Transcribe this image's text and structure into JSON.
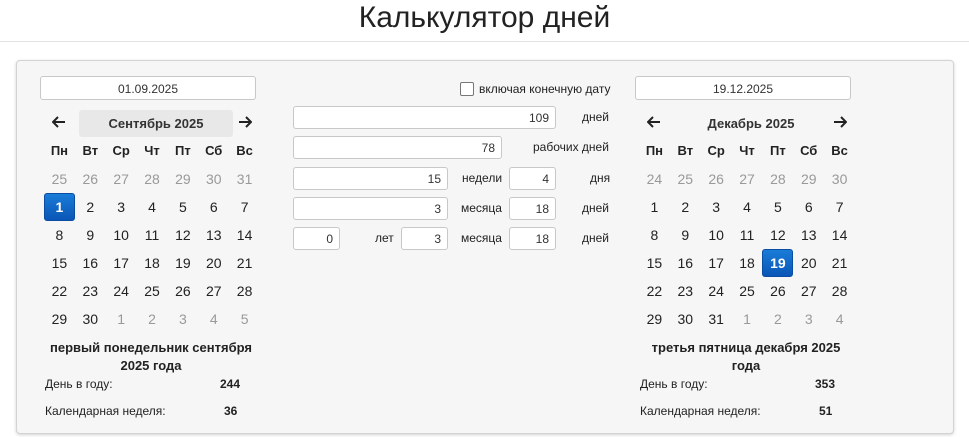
{
  "page": {
    "title": "Калькулятор дней"
  },
  "start": {
    "date": "01.09.2025",
    "calendar": {
      "month_label": "Сентябрь 2025",
      "prev_icon": "arrow-left",
      "next_icon": "arrow-right",
      "weekdays": [
        "Пн",
        "Вт",
        "Ср",
        "Чт",
        "Пт",
        "Сб",
        "Вс"
      ],
      "days": [
        {
          "d": "25",
          "muted": true
        },
        {
          "d": "26",
          "muted": true
        },
        {
          "d": "27",
          "muted": true
        },
        {
          "d": "28",
          "muted": true
        },
        {
          "d": "29",
          "muted": true
        },
        {
          "d": "30",
          "muted": true
        },
        {
          "d": "31",
          "muted": true
        },
        {
          "d": "1",
          "selected": true
        },
        {
          "d": "2"
        },
        {
          "d": "3"
        },
        {
          "d": "4"
        },
        {
          "d": "5"
        },
        {
          "d": "6"
        },
        {
          "d": "7"
        },
        {
          "d": "8"
        },
        {
          "d": "9"
        },
        {
          "d": "10"
        },
        {
          "d": "11"
        },
        {
          "d": "12"
        },
        {
          "d": "13"
        },
        {
          "d": "14"
        },
        {
          "d": "15"
        },
        {
          "d": "16"
        },
        {
          "d": "17"
        },
        {
          "d": "18"
        },
        {
          "d": "19"
        },
        {
          "d": "20"
        },
        {
          "d": "21"
        },
        {
          "d": "22"
        },
        {
          "d": "23"
        },
        {
          "d": "24"
        },
        {
          "d": "25"
        },
        {
          "d": "26"
        },
        {
          "d": "27"
        },
        {
          "d": "28"
        },
        {
          "d": "29"
        },
        {
          "d": "30"
        },
        {
          "d": "1",
          "muted": true
        },
        {
          "d": "2",
          "muted": true
        },
        {
          "d": "3",
          "muted": true
        },
        {
          "d": "4",
          "muted": true
        },
        {
          "d": "5",
          "muted": true
        }
      ]
    },
    "caption": "первый понедельник сентября 2025 года",
    "day_of_year_label": "День в году:",
    "day_of_year": "244",
    "week_label": "Календарная неделя:",
    "week": "36"
  },
  "end": {
    "date": "19.12.2025",
    "calendar": {
      "month_label": "Декабрь 2025",
      "prev_icon": "arrow-left",
      "next_icon": "arrow-right",
      "weekdays": [
        "Пн",
        "Вт",
        "Ср",
        "Чт",
        "Пт",
        "Сб",
        "Вс"
      ],
      "days": [
        {
          "d": "24",
          "muted": true
        },
        {
          "d": "25",
          "muted": true
        },
        {
          "d": "26",
          "muted": true
        },
        {
          "d": "27",
          "muted": true
        },
        {
          "d": "28",
          "muted": true
        },
        {
          "d": "29",
          "muted": true
        },
        {
          "d": "30",
          "muted": true
        },
        {
          "d": "1"
        },
        {
          "d": "2"
        },
        {
          "d": "3"
        },
        {
          "d": "4"
        },
        {
          "d": "5"
        },
        {
          "d": "6"
        },
        {
          "d": "7"
        },
        {
          "d": "8"
        },
        {
          "d": "9"
        },
        {
          "d": "10"
        },
        {
          "d": "11"
        },
        {
          "d": "12"
        },
        {
          "d": "13"
        },
        {
          "d": "14"
        },
        {
          "d": "15"
        },
        {
          "d": "16"
        },
        {
          "d": "17"
        },
        {
          "d": "18"
        },
        {
          "d": "19",
          "selected": true
        },
        {
          "d": "20"
        },
        {
          "d": "21"
        },
        {
          "d": "22"
        },
        {
          "d": "23"
        },
        {
          "d": "24"
        },
        {
          "d": "25"
        },
        {
          "d": "26"
        },
        {
          "d": "27"
        },
        {
          "d": "28"
        },
        {
          "d": "29"
        },
        {
          "d": "30"
        },
        {
          "d": "31"
        },
        {
          "d": "1",
          "muted": true
        },
        {
          "d": "2",
          "muted": true
        },
        {
          "d": "3",
          "muted": true
        },
        {
          "d": "4",
          "muted": true
        }
      ]
    },
    "caption": "третья пятница декабря 2025 года",
    "day_of_year_label": "День в году:",
    "day_of_year": "353",
    "week_label": "Календарная неделя:",
    "week": "51"
  },
  "calc": {
    "include_end_label": "включая конечную дату",
    "include_end_checked": false,
    "days_value": "109",
    "days_label": "дней",
    "workdays_value": "78",
    "workdays_label": "рабочих дней",
    "weeks_value": "15",
    "weeks_label": "недели",
    "weeks_days_value": "4",
    "weeks_days_label": "дня",
    "months_value": "3",
    "months_label": "месяца",
    "months_days_value": "18",
    "months_days_label": "дней",
    "years_value": "0",
    "years_label": "лет",
    "ym_months_value": "3",
    "ym_months_label": "месяца",
    "ym_days_value": "18",
    "ym_days_label": "дней"
  },
  "colors": {
    "selected": "#0a56b6",
    "panel": "#f6f6f6",
    "muted_day": "#999999"
  }
}
